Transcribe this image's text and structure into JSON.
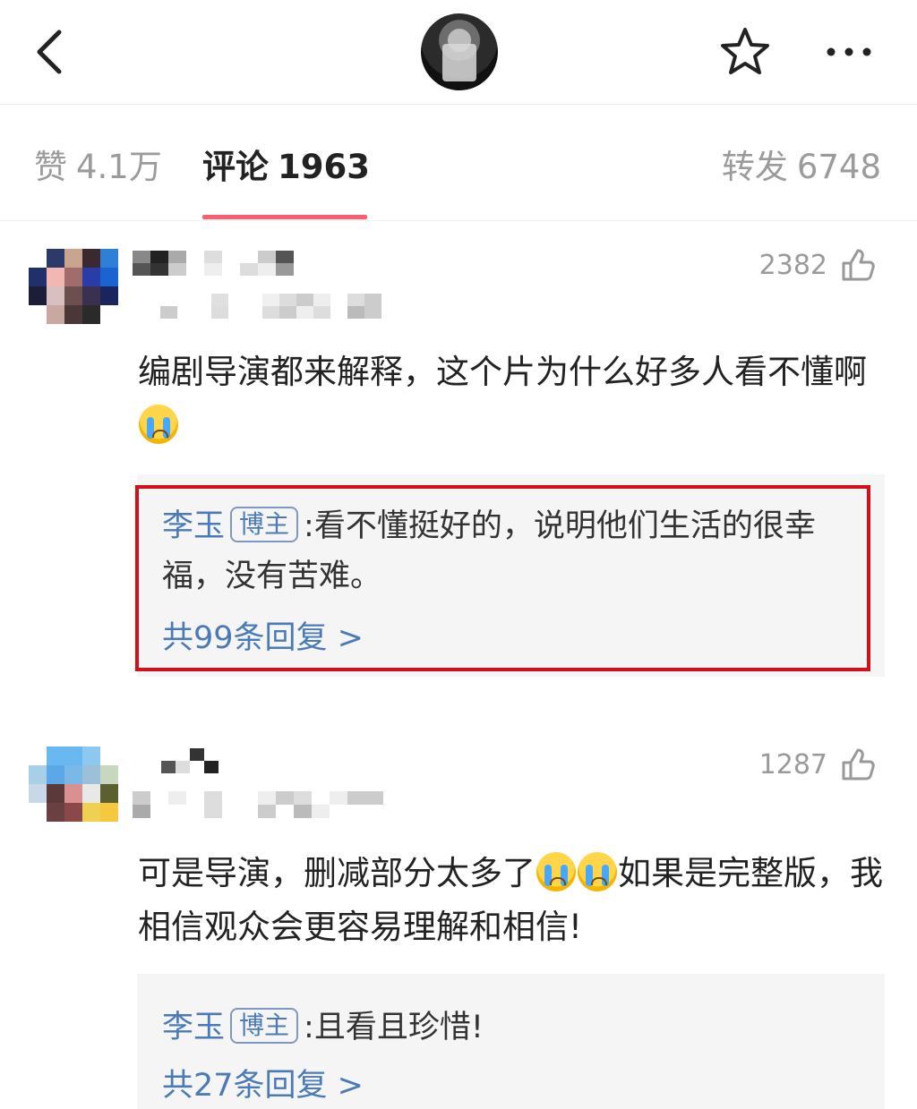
{
  "tabs": {
    "like": {
      "label": "赞",
      "count": "4.1万"
    },
    "comment": {
      "label": "评论",
      "count": "1963"
    },
    "repost": {
      "label": "转发",
      "count": "6748"
    }
  },
  "comments": [
    {
      "likes": "2382",
      "text_part1": "编剧导演都来解释，这个片为什么好多人看不懂啊",
      "reply": {
        "author": "李玉",
        "badge": "博主",
        "text": "看不懂挺好的，说明他们生活的很幸福，没有苦难。",
        "more": "共99条回复 >"
      }
    },
    {
      "likes": "1287",
      "text_part1": "可是导演，删减部分太多了",
      "text_part2": "如果是完整版，我相信观众会更容易理解和相信!",
      "reply": {
        "author": "李玉",
        "badge": "博主",
        "text": "且看且珍惜!",
        "more": "共27条回复 >"
      }
    }
  ],
  "icons": [
    "back-icon",
    "star-icon",
    "more-icon",
    "thumbs-up-icon",
    "crying-emoji-icon"
  ],
  "colors": {
    "accent": "#ff5c6e",
    "link": "#4a7bb7",
    "highlight_box": "#d3101a"
  }
}
